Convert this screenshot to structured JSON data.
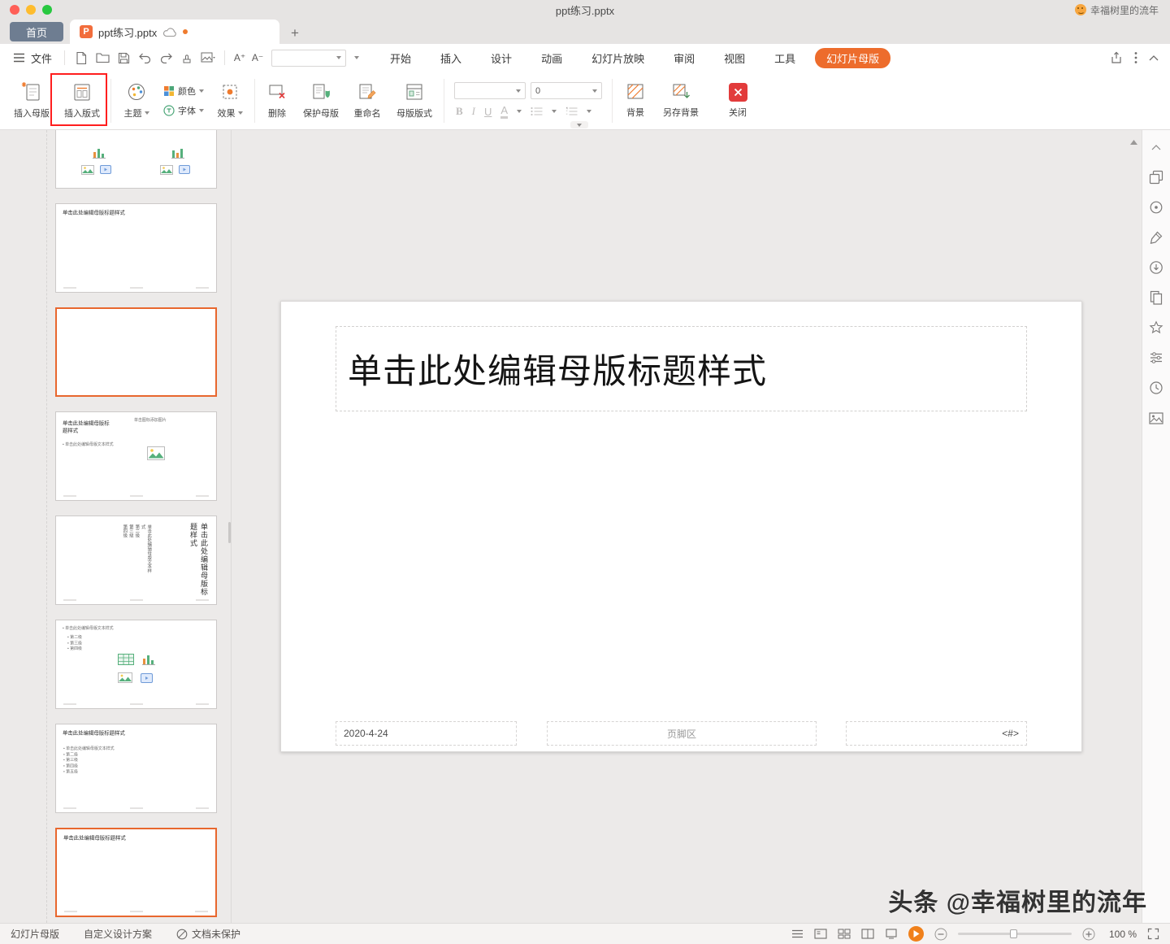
{
  "titlebar": {
    "title": "ppt练习.pptx",
    "user": "幸福树里的流年"
  },
  "tabbar": {
    "home": "首页",
    "doc": "ppt练习.pptx",
    "logo": "P",
    "add": "+"
  },
  "menubar": {
    "file": "文件",
    "font_bigger": "A⁺",
    "font_smaller": "A⁻",
    "tabs": [
      "开始",
      "插入",
      "设计",
      "动画",
      "幻灯片放映",
      "审阅",
      "视图",
      "工具"
    ],
    "active": "幻灯片母版"
  },
  "ribbon": {
    "insert_master": "插入母版",
    "insert_layout": "插入版式",
    "theme": "主题",
    "colors": "颜色",
    "fonts": "字体",
    "effects": "效果",
    "delete": "删除",
    "protect": "保护母版",
    "rename": "重命名",
    "master_layout": "母版版式",
    "font_name": "",
    "font_size": "0",
    "bold": "B",
    "italic": "I",
    "underline": "U",
    "font_color": "A",
    "background": "背景",
    "save_background": "另存背景",
    "close": "关闭"
  },
  "thumbnails": {
    "title_ph": "单击此处编辑母版标题样式",
    "title_ph_wrap": "单击此处编辑母版标\n题样式",
    "text_ph": "• 单击此处编辑母版文本样式",
    "pic_ph": "单击图标添加图片",
    "levels": "• 第二级\n• 第三级\n• 第四级",
    "vertical_body": "单击此处编辑母版文本样式\n第二级\n第三级\n第四级",
    "body_lines": "• 单击此处编辑母版文本样式\n• 第二级\n• 第三级\n• 第四级\n• 第五级"
  },
  "slide": {
    "title": "单击此处编辑母版标题样式",
    "date": "2020-4-24",
    "footer": "页脚区",
    "pagenum": "<#>"
  },
  "statusbar": {
    "view": "幻灯片母版",
    "scheme": "自定义设计方案",
    "protect": "文档未保护",
    "zoom": "100 %"
  },
  "watermark": "头条 @幸福树里的流年",
  "colors": {
    "accent": "#ed6c2c",
    "selection": "#e8672e",
    "annotation": "#ff1e1e",
    "close": "#e23b3b"
  }
}
